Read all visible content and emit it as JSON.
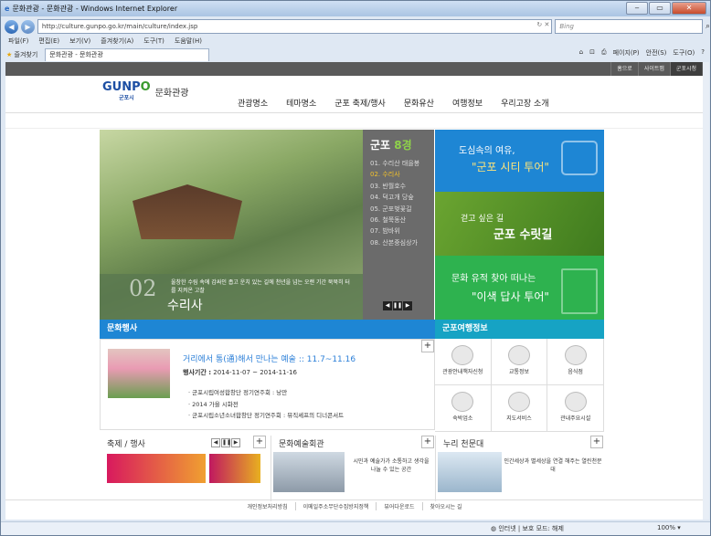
{
  "window": {
    "title": "문화관광 - 문화관광 - Windows Internet Explorer"
  },
  "browser": {
    "address": "http://culture.gunpo.go.kr/main/culture/index.jsp",
    "search_placeholder": "Bing",
    "menus": [
      "파일(F)",
      "편집(E)",
      "보기(V)",
      "즐겨찾기(A)",
      "도구(T)",
      "도움말(H)"
    ],
    "fav_label": "즐겨찾기",
    "tab_title": "문화관광 - 문화관광",
    "commands": [
      "페이지(P)",
      "안전(S)",
      "도구(O)"
    ],
    "status_zone": "인터넷 | 보호 모드: 해제",
    "zoom": "100%"
  },
  "util": [
    "홈으로",
    "사이트맵",
    "군포시청"
  ],
  "logo": {
    "brand1": "GUNP",
    "brand2": "O",
    "sub": "군포시",
    "title": "문화관광"
  },
  "gnb": [
    "관광명소",
    "테마명소",
    "군포 축제/행사",
    "문화유산",
    "여행정보",
    "우리고장 소개"
  ],
  "hero": {
    "number": "02",
    "desc": "울창한 수림 속에 감싸인 좁고 운치 있는 길에 천년을 넘는 오랜 기간 묵묵히 터를 지켜온 고찰",
    "name": "수리사"
  },
  "eight": {
    "head1": "군포",
    "head2": "8경",
    "items": [
      "01. 수리산 태을봉",
      "02. 수리사",
      "03. 반월호수",
      "04. 덕고개 당숲",
      "05. 군포벚꽃길",
      "06. 철쭉동산",
      "07. 밤바위",
      "08. 산본중심상가"
    ],
    "controls": [
      "◀",
      "❚❚",
      "▶"
    ]
  },
  "banners": {
    "b1a": "도심속의 여유,",
    "b1b": "\"군포 시티 투어\"",
    "b2a": "걷고 싶은 길",
    "b2b": "군포 수릿길",
    "b3a": "문화 유적 찾아 떠나는",
    "b3b": "\"이색 답사 투어\""
  },
  "events": {
    "heading": "문화행사",
    "title": "거리에서 통(通)해서 만나는 예술 :: 11.7~11.16",
    "period_label": "행사기간 :",
    "period": "2014-11-07 ~ 2014-11-16",
    "items": [
      "군포시립여성합창단 정기연주회 : 낭만",
      "2014 가을 시화전",
      "군포시립소년소녀합창단 정기연주회 : 뮤직셰프의 디너콘서트"
    ]
  },
  "tour": {
    "heading": "군포여행정보",
    "items": [
      "관광안내책자신청",
      "교통정보",
      "음식점",
      "숙박업소",
      "지도서비스",
      "관내주요시설"
    ]
  },
  "bottom": {
    "fest": "축제 / 행사",
    "hall": "문화예술회관",
    "hall_text": "시민과 예술가가 소통하고 생각을 나눌 수 있는 공간",
    "obs": "누리 천문대",
    "obs_text": "인간세상과 별세상을 연결 해주는 열린천문대",
    "fest_controls": [
      "◀",
      "❚❚",
      "▶"
    ]
  },
  "footer": [
    "개인정보처리방침",
    "이메일주소무단수집방지정책",
    "뷰어다운로드",
    "찾아오시는 길"
  ],
  "colors": {
    "blue": "#1e86d4",
    "green": "#2eb24f",
    "teal": "#16a3c4"
  }
}
